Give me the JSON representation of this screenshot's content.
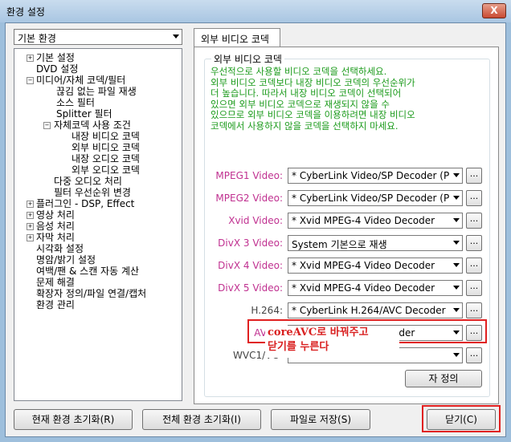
{
  "window": {
    "title": "환경 설정",
    "close_glyph": "X"
  },
  "category_select": {
    "value": "기본 환경"
  },
  "tree": {
    "items": [
      {
        "label": "기본 설정",
        "expander": "+"
      },
      {
        "label": "DVD 설정"
      },
      {
        "label": "미디어/자체 코덱/필터",
        "expander": "−"
      },
      {
        "label": "끊김 없는 파일 재생"
      },
      {
        "label": "소스 필터"
      },
      {
        "label": "Splitter 필터"
      },
      {
        "label": "자체코덱 사용 조건",
        "expander": "−"
      },
      {
        "label": "내장 비디오 코덱"
      },
      {
        "label": "외부 비디오 코덱"
      },
      {
        "label": "내장 오디오 코덱"
      },
      {
        "label": "외부 오디오 코덱"
      },
      {
        "label": "다중 오디오 처리"
      },
      {
        "label": "필터 우선순위 변경"
      },
      {
        "label": "플러그인 - DSP, Effect",
        "expander": "+"
      },
      {
        "label": "영상 처리",
        "expander": "+"
      },
      {
        "label": "음성 처리",
        "expander": "+"
      },
      {
        "label": "자막 처리",
        "expander": "+"
      },
      {
        "label": "시각화 설정"
      },
      {
        "label": "명암/밝기 설정"
      },
      {
        "label": "여백/팬 & 스캔 자동 계산"
      },
      {
        "label": "문제 해결"
      },
      {
        "label": "확장자 정의/파일 연결/캡처"
      },
      {
        "label": "환경 관리"
      }
    ]
  },
  "tab": {
    "label": "외부 비디오 코덱"
  },
  "group": {
    "title": "외부 비디오 코덱",
    "description": "우선적으로 사용할 비디오 코덱을 선택하세요.\n외부 비디오 코덱보다 내장 비디오 코덱의 우선순위가\n더 높습니다. 따라서 내장 비디오 코덱이 선택되어\n있으면 외부 비디오 코덱으로 재생되지 않을 수\n있으므로 외부 비디오 코덱을 이용하려면 내장 비디오\n코덱에서 사용하지 않을 코덱을 선택하지 마세요."
  },
  "codecs": [
    {
      "label": "MPEG1 Video:",
      "value": "* CyberLink Video/SP Decoder (P"
    },
    {
      "label": "MPEG2 Video:",
      "value": "* CyberLink Video/SP Decoder (P"
    },
    {
      "label": "Xvid Video:",
      "value": "* Xvid MPEG-4 Video Decoder"
    },
    {
      "label": "DivX 3 Video:",
      "value": "System 기본으로 재생"
    },
    {
      "label": "DivX 4 Video:",
      "value": "* Xvid MPEG-4 Video Decoder"
    },
    {
      "label": "DivX 5 Video:",
      "value": "* Xvid MPEG-4 Video Decoder"
    },
    {
      "label": "H.264:",
      "value": "* CyberLink H.264/AVC Decoder ("
    },
    {
      "label": "AVC1:",
      "value": "* CoreAVC Video Decoder"
    },
    {
      "label": "WVC1/VC",
      "value": ""
    }
  ],
  "dots_label": "...",
  "partial_button": {
    "label": "자 정의"
  },
  "annotation": {
    "line1": "coreAVC로 바꿔주고",
    "line2": "닫기를 누른다"
  },
  "buttons": {
    "reset_current": "현재 환경 초기화(R)",
    "reset_all": "전체 환경 초기화(I)",
    "save_file": "파일로 저장(S)",
    "close": "닫기(C)"
  },
  "colors": {
    "description": "#1a9a1a",
    "codec_label": "#c03090",
    "annotation": "#d91f1f",
    "highlight_box": "#e02020"
  }
}
